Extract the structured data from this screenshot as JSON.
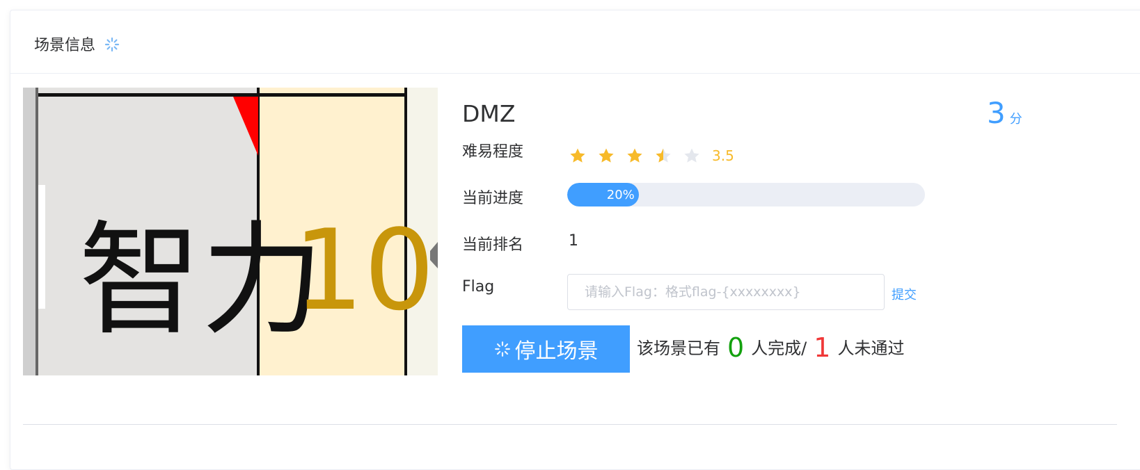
{
  "header": {
    "title": "场景信息",
    "icon": "loading-spinner-icon"
  },
  "scene": {
    "name": "DMZ",
    "score_value": "3",
    "score_unit": "分",
    "cover": {
      "text": "智力",
      "number": "10"
    }
  },
  "difficulty": {
    "label": "难易程度",
    "rating": 3.5,
    "max": 5,
    "rating_text": "3.5",
    "color": "#f7ba2a"
  },
  "progress": {
    "label": "当前进度",
    "percent": 20,
    "text": "20%",
    "color": "#409eff"
  },
  "rank": {
    "label": "当前排名",
    "value": "1"
  },
  "flag": {
    "label": "Flag",
    "placeholder": "请输入Flag：格式flag-{xxxxxxxx}",
    "submit_label": "提交"
  },
  "actions": {
    "stop_label": "停止场景",
    "stop_icon": "loading-spinner-icon"
  },
  "stats": {
    "prefix": "该场景已有",
    "completed": "0",
    "completed_suffix": "人完成/",
    "failed": "1",
    "failed_suffix": "人未通过",
    "completed_color": "#13a10e",
    "failed_color": "#f03838"
  },
  "colors": {
    "primary": "#409eff",
    "star": "#f7ba2a",
    "star_empty": "#e4e7ed"
  }
}
